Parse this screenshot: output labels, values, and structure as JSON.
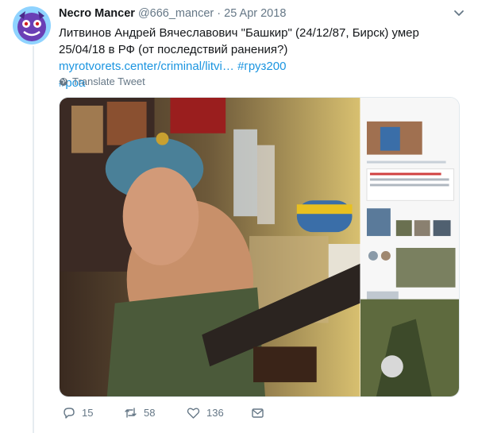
{
  "tweet": {
    "display_name": "Necro Mancer",
    "handle": "@666_mancer",
    "separator": "·",
    "date": "25 Apr 2018",
    "text_main": "Литвинов Андрей Вячеславович \"Башкир\" (24/12/87, Бирск) умер 25/04/18 в РФ (от последствий ранения?) ",
    "link": "myrotvorets.center/criminal/litvi…",
    "hashtag1": "#груз200",
    "hashtag2": "#роа",
    "translate_label": "Translate Tweet"
  },
  "actions": {
    "reply_count": "15",
    "retweet_count": "58",
    "like_count": "136"
  },
  "colors": {
    "link": "#1b95e0",
    "muted": "#657786",
    "text": "#14171a",
    "thread_line": "#e6ecf0"
  },
  "icons": [
    "avatar",
    "chevron-down-icon",
    "globe-icon",
    "reply-icon",
    "retweet-icon",
    "like-icon",
    "message-icon"
  ]
}
